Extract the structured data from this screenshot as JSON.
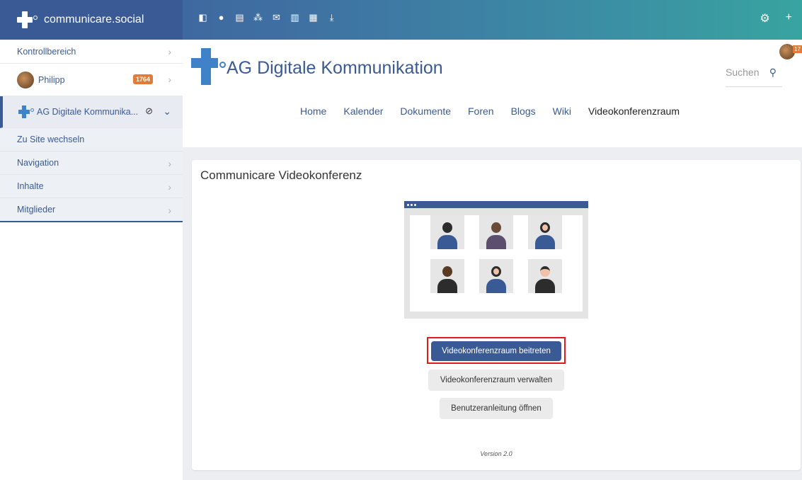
{
  "brand": {
    "title": "communicare.social"
  },
  "topbar": {
    "icons": [
      "sidebar-toggle-icon",
      "user-icon",
      "clipboard-icon",
      "group-icon",
      "mail-icon",
      "contacts-icon",
      "document-search-icon",
      "download-icon"
    ],
    "right_icons": [
      "settings-icon",
      "plus-icon"
    ]
  },
  "sidebar": {
    "control_panel": "Kontrollbereich",
    "user": {
      "name": "Philipp",
      "badge": "1764"
    },
    "site": {
      "name": "AG Digitale Kommunika..."
    },
    "sub_items": [
      {
        "label": "Zu Site wechseln"
      },
      {
        "label": "Navigation"
      },
      {
        "label": "Inhalte"
      },
      {
        "label": "Mitglieder"
      }
    ]
  },
  "header": {
    "site_title": "AG Digitale Kommunikation",
    "search_placeholder": "Suchen",
    "avatar_badge": "17"
  },
  "nav": {
    "items": [
      "Home",
      "Kalender",
      "Dokumente",
      "Foren",
      "Blogs",
      "Wiki",
      "Videokonferenzraum"
    ],
    "active": "Videokonferenzraum"
  },
  "card": {
    "title": "Communicare Videokonferenz",
    "join_button": "Videokonferenzraum beitreten",
    "manage_button": "Videokonferenzraum verwalten",
    "guide_button": "Benutzeranleitung öffnen",
    "version": "Version 2.0"
  },
  "colors": {
    "primary": "#3a5a96",
    "accent": "#3f82c8",
    "badge": "#e07b39",
    "highlight": "#e01b1b"
  }
}
